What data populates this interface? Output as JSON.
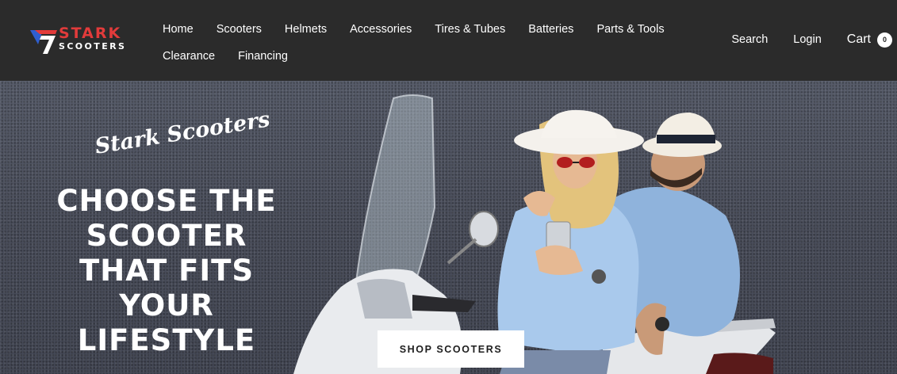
{
  "brand": {
    "name_top": "STARK",
    "name_bottom": "SCOOTERS",
    "logo_icon": "stark-7-logo-icon",
    "colors": {
      "red": "#e23b3b",
      "blue": "#2f5fd0",
      "header_bg": "#2b2b2b"
    }
  },
  "nav": {
    "row1": [
      "Home",
      "Scooters",
      "Helmets",
      "Accessories",
      "Tires & Tubes",
      "Batteries",
      "Parts & Tools"
    ],
    "row2": [
      "Clearance",
      "Financing"
    ]
  },
  "utility": {
    "search_label": "Search",
    "login_label": "Login",
    "cart_label": "Cart",
    "cart_count": "0"
  },
  "hero": {
    "tagline": "Stark Scooters",
    "headline_lines": [
      "CHOOSE THE",
      "SCOOTER",
      "THAT FITS",
      "YOUR",
      "LIFESTYLE"
    ],
    "cta_label": "SHOP SCOOTERS"
  }
}
